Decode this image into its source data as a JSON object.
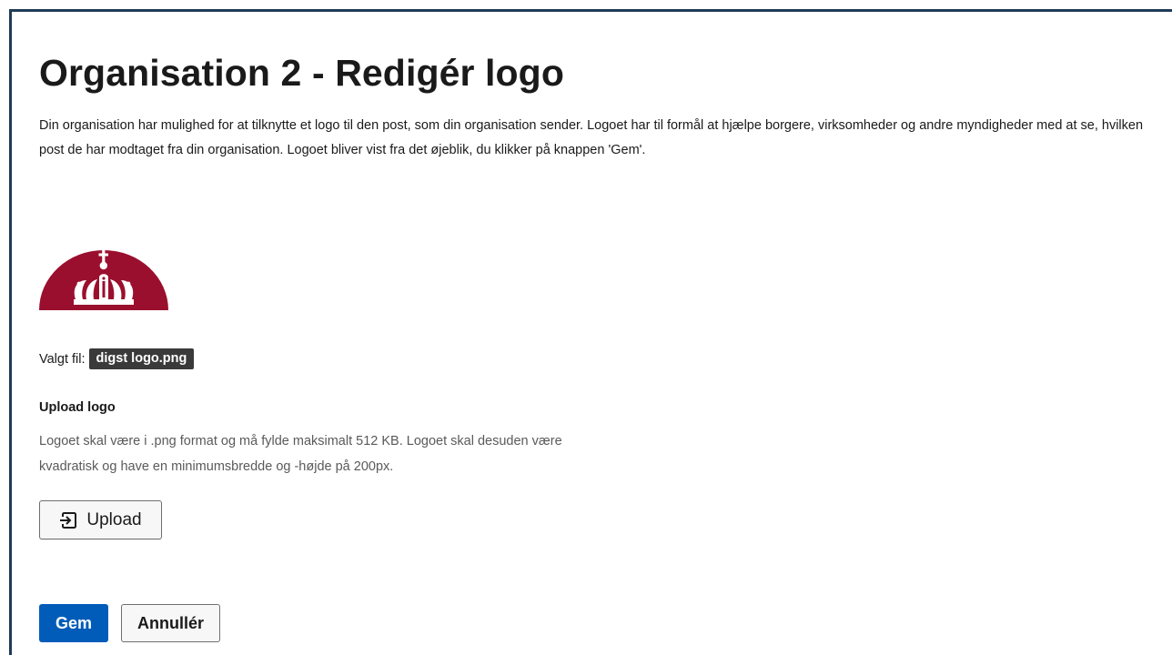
{
  "page": {
    "title": "Organisation 2 - Redigér logo",
    "intro": "Din organisation har mulighed for at tilknytte et logo til den post, som din organisation sender. Logoet har til formål at hjælpe borgere, virksomheder og andre myndigheder med at se, hvilken post de har modtaget fra din organisation. Logoet bliver vist fra det øjeblik, du klikker på knappen 'Gem'."
  },
  "logo": {
    "icon": "crown-logo-icon",
    "color": "#9b0f2e"
  },
  "chosen_file": {
    "label": "Valgt fil:",
    "filename": "digst logo.png"
  },
  "upload": {
    "heading": "Upload logo",
    "help": "Logoet skal være i .png format og må fylde maksimalt 512 KB. Logoet skal desuden være kvadratisk og have en minimumsbredde og -højde på 200px.",
    "button_label": "Upload",
    "button_icon": "upload-icon"
  },
  "actions": {
    "save_label": "Gem",
    "cancel_label": "Annullér",
    "primary_color": "#005cb8"
  }
}
